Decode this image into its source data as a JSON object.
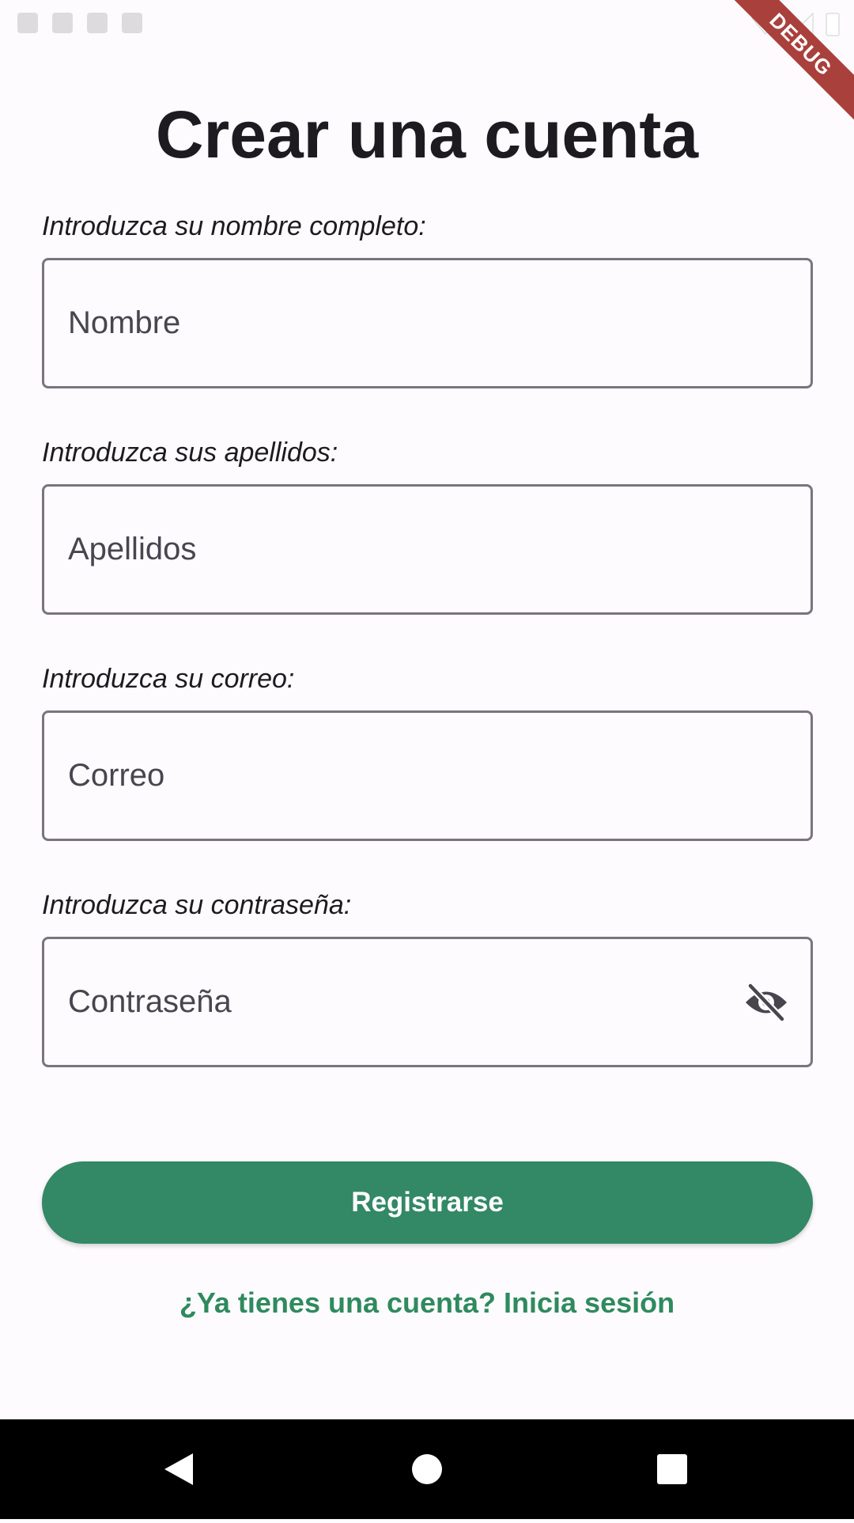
{
  "debug_banner": "DEBUG",
  "title": "Crear una cuenta",
  "fields": [
    {
      "label": "Introduzca su nombre completo:",
      "placeholder": "Nombre"
    },
    {
      "label": "Introduzca sus apellidos:",
      "placeholder": "Apellidos"
    },
    {
      "label": "Introduzca su correo:",
      "placeholder": "Correo"
    },
    {
      "label": "Introduzca su contraseña:",
      "placeholder": "Contraseña",
      "trailing_icon": "visibility-off-icon"
    }
  ],
  "register_button": "Registrarse",
  "login_link": "¿Ya tienes una cuenta? Inicia sesión",
  "nav_bar": {
    "icons": [
      "back-icon",
      "home-icon",
      "recents-icon"
    ]
  },
  "colors": {
    "background": "#fefbfe",
    "primary": "#338866",
    "link": "#2f8a5e",
    "outline": "#79747e",
    "text": "#1d1b20"
  }
}
